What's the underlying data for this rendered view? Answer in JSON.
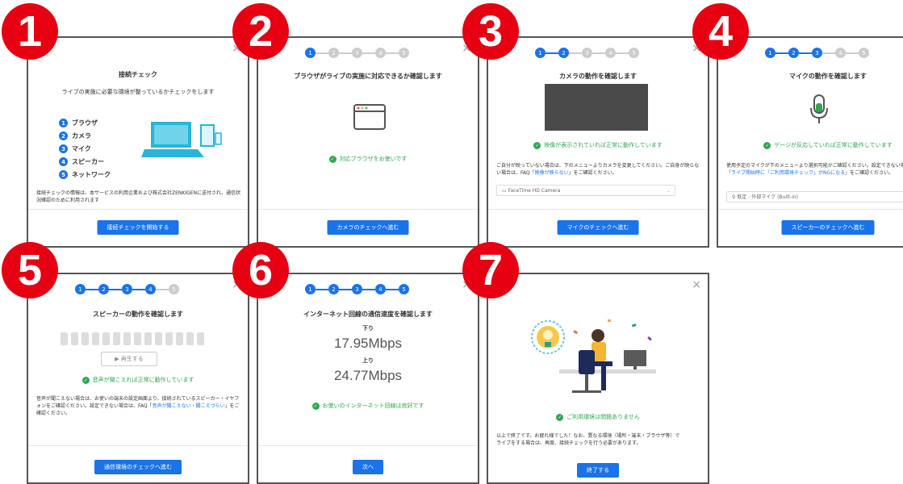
{
  "close_glyph": "×",
  "panels": [
    {
      "badge": "1",
      "title": "接続チェック",
      "subtitle": "ライブの実施に必要な環境が整っているかチェックをします",
      "checklist": [
        "ブラウザ",
        "カメラ",
        "マイク",
        "スピーカー",
        "ネットワーク"
      ],
      "checklist_nums": [
        "1",
        "2",
        "3",
        "4",
        "5"
      ],
      "note": "接続チェックの情報は、本サービスの利用企業および株式会社ZENKIGENに送付され、通信状況確認のために利用されます",
      "button": "接続チェックを開始する"
    },
    {
      "badge": "2",
      "steps": [
        "1",
        "2",
        "3",
        "4",
        "5"
      ],
      "active_steps": 1,
      "title": "ブラウザがライブの実施に対応できるか確認します",
      "status": "対応ブラウザをお使いです",
      "button": "カメラのチェックへ進む"
    },
    {
      "badge": "3",
      "steps": [
        "1",
        "2",
        "3",
        "4",
        "5"
      ],
      "active_steps": 2,
      "title": "カメラの動作を確認します",
      "status": "映像が表示されていれば正常に動作しています",
      "help_a": "ご自分が映っていない場合は、下のメニューよりカメラを変更してください。ご自身が映らない場合は、FAQ「",
      "help_link": "映像が映らない",
      "help_b": "」をご確認ください。",
      "select": "FaceTime HD Camera",
      "button": "マイクのチェックへ進む"
    },
    {
      "badge": "4",
      "steps": [
        "1",
        "2",
        "3",
        "4",
        "5"
      ],
      "active_steps": 3,
      "title": "マイクの動作を確認します",
      "status": "ゲージが反応していれば正常に動作しています",
      "help_a": "使用予定のマイクが下のメニューより選択可能かご確認ください。設定できない場合は、FAQ「",
      "help_link": "ライブ開始時に「ご利用環境チェック」がNGになる",
      "help_b": "」をご確認ください。",
      "select": "既定 - 外部マイク (Built-in)",
      "button": "スピーカーのチェックへ進む"
    },
    {
      "badge": "5",
      "steps": [
        "1",
        "2",
        "3",
        "4",
        "5"
      ],
      "active_steps": 4,
      "title": "スピーカーの動作を確認します",
      "play": "再生する",
      "status": "音声が聞こえれば正常に動作しています",
      "help_a": "音声が聞こえない場合は、お使いの端末の設定画面より、接続されているスピーカー・イヤフォンをご確認ください。設定できない場合は、FAQ「",
      "help_link": "音声が聞こえない・聞こえづらい",
      "help_b": "」をご確認ください。",
      "button": "通信環境のチェックへ進む"
    },
    {
      "badge": "6",
      "steps": [
        "1",
        "2",
        "3",
        "4",
        "5"
      ],
      "active_steps": 5,
      "title": "インターネット回線の通信速度を確認します",
      "down_label": "下り",
      "down_value": "17.95Mbps",
      "up_label": "上り",
      "up_value": "24.77Mbps",
      "status": "お使いのインターネット回線は良好です",
      "button": "次へ"
    },
    {
      "badge": "7",
      "status": "ご利用環境は問題ありません",
      "help": "以上で終了です。お疲れ様でした！なお、異なる環境（場所・端末・ブラウザ等）でライブをする場合は、再度、接続チェックを行う必要があります。",
      "button": "終了する"
    }
  ]
}
